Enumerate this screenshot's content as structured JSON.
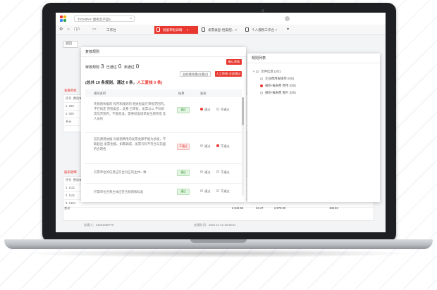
{
  "browser": {
    "address": "TATAIPAY 虚拟云产品1",
    "tabs": [
      {
        "label": "工作台",
        "active": false
      },
      {
        "label": "批复审批详情",
        "active": true
      },
      {
        "label": "发票类型-档案配... ×",
        "active": false
      },
      {
        "label": "个人报税工作台 ×",
        "active": false
      }
    ]
  },
  "underlay": {
    "button": "驳回",
    "sections": [
      "查看审批",
      "报表明细"
    ],
    "headers": [
      "序号",
      "费用单"
    ],
    "rows": [
      "1",
      "2",
      "3"
    ],
    "row_ids": [
      "000",
      "000",
      "1111",
      "1111",
      "2164"
    ],
    "totals": [
      "合计",
      "合计"
    ],
    "amounts": [
      "2,944.53",
      "23.47",
      "2,978.00",
      "166.82"
    ],
    "footer_left": "创建人：13331558779",
    "footer_right": "创建时间：2021-11-10 18:48:01"
  },
  "left_dialog": {
    "title": "复核规则",
    "count_label_1": "审核规则",
    "count_1": "3",
    "count_label_2": "已通过",
    "count_2": "0",
    "count_label_3": "未通过",
    "count_3": "0",
    "btn_confirm": "确认审核",
    "btn_pass_all": "全部规则通过(通过)",
    "btn_manual": "人工审核-全部通过",
    "summary_prefix": "(总共 10 条规则，通过 0 条，",
    "summary_red": "人工复核 0 条)",
    "columns": [
      "规则说明",
      "结果",
      "复核"
    ],
    "items": [
      {
        "text": "先规则依据的 程序和规则的 相关批复在审批范围内，不在指定 范围类型，此费 已审批，发票与以 不同的实际范围内，不能批准。需要前面请求发生期完成 及人员的",
        "status": "通过",
        "status_type": "ok",
        "pass": "通过",
        "fail": "不通过",
        "selected": "pass"
      },
      {
        "text": "首先费用依据 对报销费用的发票金额不能为多报，不能超出 发票金额。如需调减，发票号码不符合与前面的合理性",
        "status": "不通过",
        "status_type": "no",
        "pass": "通过",
        "fail": "不通过",
        "selected": "fail"
      },
      {
        "text": "开票单位的信息应符合对应的主体一致",
        "status": "通过",
        "status_type": "ok",
        "pass": "通过",
        "fail": "不通过",
        "selected": "none"
      },
      {
        "text": "开票单位名称主体应符合规则和标准",
        "status": "通过",
        "status_type": "ok",
        "pass": "通过",
        "fail": "不通过",
        "selected": "none"
      }
    ]
  },
  "right_dialog": {
    "title": "规则列表",
    "nodes": [
      {
        "label": "文件信息 (2/2)",
        "level": 0,
        "arrow": "▾",
        "selected": false
      },
      {
        "label": "企业费用报销单 (0/0)",
        "level": 1,
        "arrow": "",
        "selected": false
      },
      {
        "label": "规则-报表费 费用 (0/0)",
        "level": 1,
        "arrow": "",
        "selected": true
      },
      {
        "label": "规则-报表费 图片 (0/0)",
        "level": 1,
        "arrow": "",
        "selected": false
      }
    ]
  },
  "colors": {
    "accent": "#e8382f",
    "ok": "#3a9a3a",
    "bezel": "#1d1f22"
  }
}
